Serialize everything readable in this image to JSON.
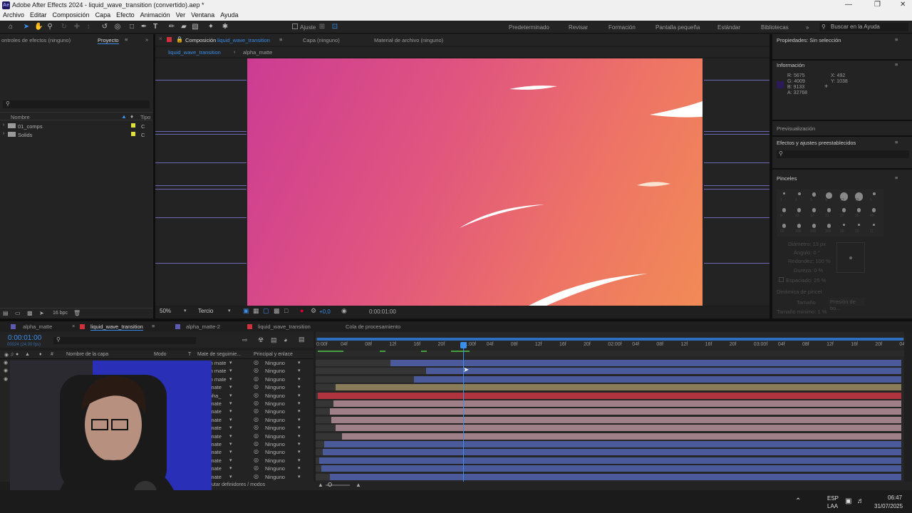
{
  "window": {
    "title": "Adobe After Effects 2024 - liquid_wave_transition (convertido).aep *",
    "app_badge": "Ae"
  },
  "menu": [
    "Archivo",
    "Editar",
    "Composición",
    "Capa",
    "Efecto",
    "Animación",
    "Ver",
    "Ventana",
    "Ayuda"
  ],
  "toolbar": {
    "snap_label": "Ajuste",
    "workspaces": [
      "Predeterminado",
      "Revisar",
      "Formación",
      "Pantalla pequeña",
      "Estándar",
      "Bibliotecas"
    ],
    "more": "»",
    "search_placeholder": "Buscar en la Ayuda"
  },
  "left_panel": {
    "tab_effects": "ontroles de efectos (ninguno)",
    "tab_project": "Proyecto",
    "col_name": "Nombre",
    "col_type": "Tipo",
    "items": [
      {
        "name": "01_comps",
        "type": "C"
      },
      {
        "name": "Solids",
        "type": "C"
      }
    ],
    "bpc": "16 bpc"
  },
  "viewer": {
    "tab_comp_prefix": "Composición",
    "tab_comp_name": "liquid_wave_transition",
    "tab_layer": "Capa (ninguno)",
    "tab_footage": "Material de archivo (ninguno)",
    "subtabs": [
      "liquid_wave_transition",
      "alpha_matte"
    ],
    "zoom": "50%",
    "resolution": "Tercio",
    "exposure": "+0,0",
    "timecode": "0:00:01:00"
  },
  "right_panel": {
    "properties": "Propiedades: Sin selección",
    "info_title": "Información",
    "info_r": "R: 5675",
    "info_g": "G: 4009",
    "info_b": "B: 9133",
    "info_a": "A: 32768",
    "info_x": "X: 492",
    "info_y": "Y: 1038",
    "preview": "Previsualización",
    "effects": "Efectos y ajustes preestablecidos",
    "brushes": "Pinceles",
    "brush_sizes": [
      "1",
      "3",
      "5",
      "9",
      "13",
      "19",
      "5",
      "9",
      "13",
      "17",
      "21",
      "27",
      "35",
      "45",
      "65",
      "100",
      "200",
      "300",
      "15",
      "15",
      "11"
    ],
    "diameter": "Diámetro: 13 px",
    "angle": "Ángulo: 0 °",
    "roundness": "Redondez: 100 %",
    "hardness": "Dureza: 0 %",
    "spacing": "Espaciado: 25 %",
    "dynamics": "Dinámica de pincel",
    "size_label": "Tamaño",
    "size_value": "Presión de bo...",
    "min_size": "Tamaño mínimo: 1 %",
    "accent_color": "#2d8ceb"
  },
  "timeline": {
    "tabs": [
      "alpha_matte",
      "liquid_wave_transition",
      "alpha_matte-2",
      "liquid_wave_transition",
      "Cola de procesamiento"
    ],
    "timecode": "0:00:01:00",
    "frame_info": "00024 (24.00 fps)",
    "col_hash": "#",
    "col_layer": "Nombre de la capa",
    "col_mode": "Modo",
    "col_t": "T",
    "col_track": "Mate de seguimie...",
    "col_parent": "Principal y enlace",
    "ruler": [
      "0:00f",
      "04f",
      "08f",
      "12f",
      "16f",
      "20f",
      "01:00f",
      "04f",
      "08f",
      "12f",
      "16f",
      "20f",
      "02:00f",
      "04f",
      "08f",
      "12f",
      "16f",
      "20f",
      "03:00f",
      "04f",
      "08f",
      "12f",
      "16f",
      "20f",
      "04:0"
    ],
    "track_values": [
      "Sin mate",
      "Sin mate",
      "Sin mate",
      "n mate",
      "alpha_",
      "n mate",
      "n mate",
      "n mate",
      "n mate",
      "n mate",
      "n mate",
      "n mate",
      "n mate",
      "n mate",
      "n mate"
    ],
    "parent_values": [
      "Ninguno",
      "Ninguno",
      "Ninguno",
      "Ninguno",
      "Ninguno",
      "Ninguno",
      "Ninguno",
      "Ninguno",
      "Ninguno",
      "Ninguno",
      "Ninguno",
      "Ninguno",
      "Ninguno",
      "Ninguno",
      "Ninguno"
    ],
    "footer": "utar definidores / modos"
  },
  "taskbar": {
    "lang1": "ESP",
    "lang2": "LAA",
    "time": "06:47",
    "date": "31/07/2025"
  }
}
